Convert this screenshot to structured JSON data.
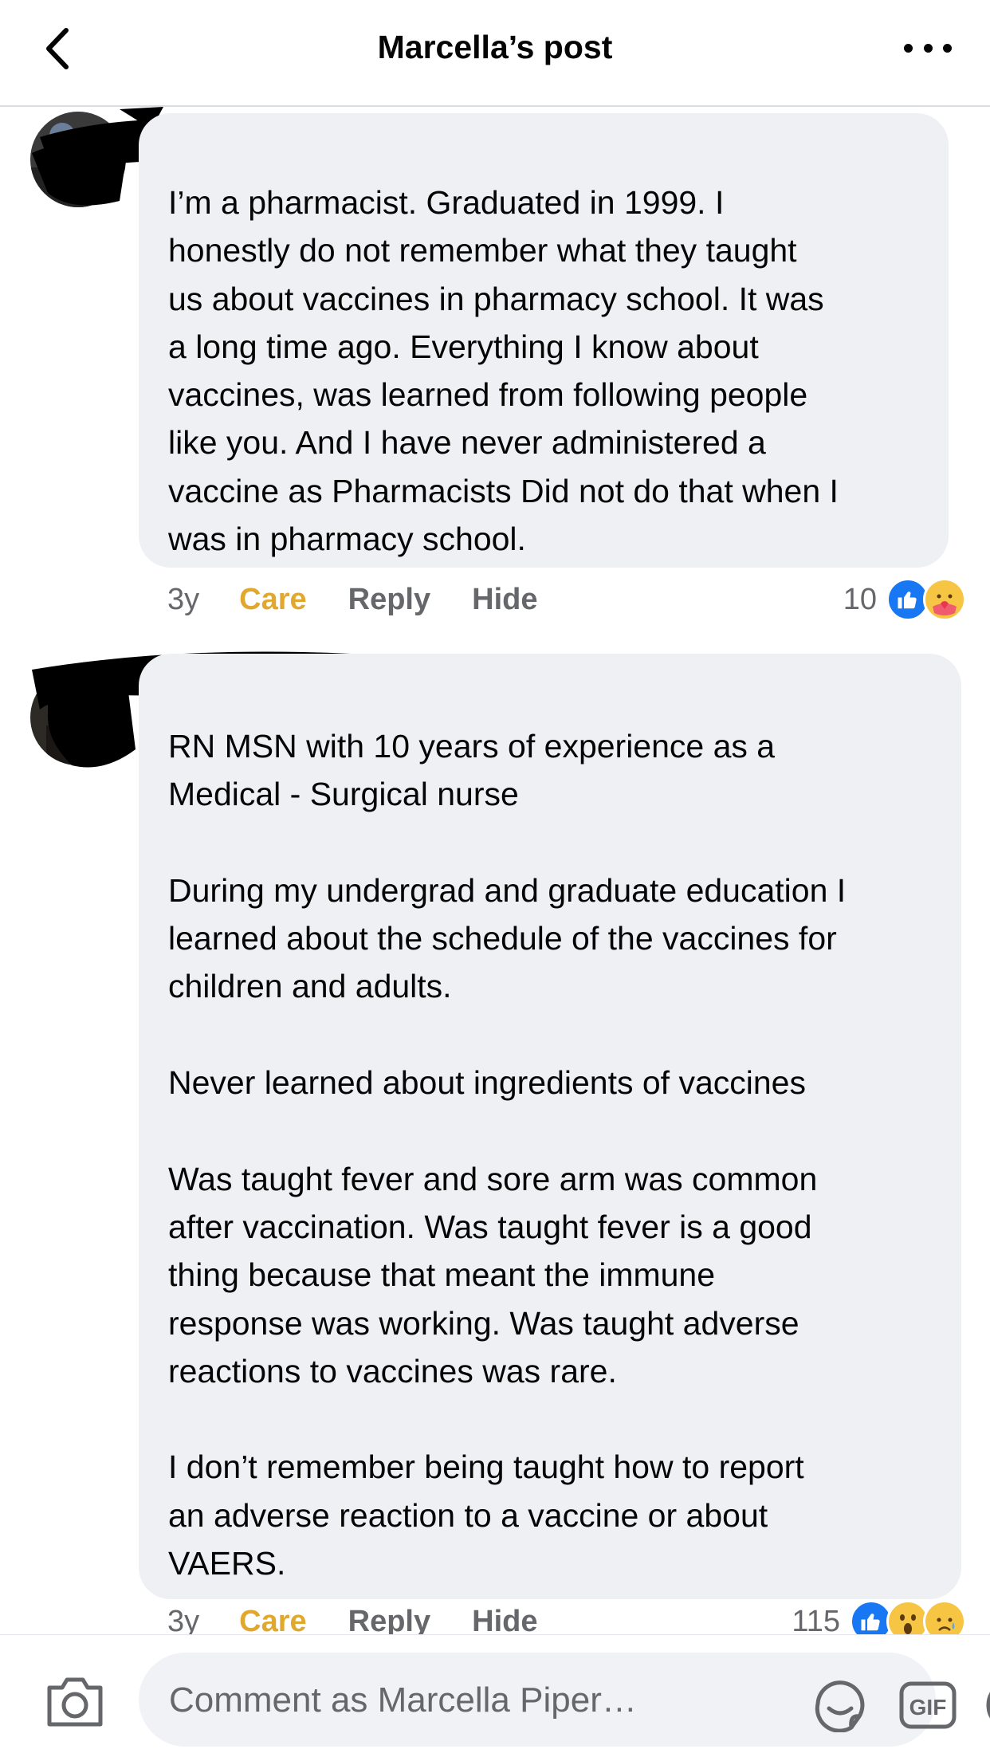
{
  "header": {
    "title": "Marcella’s post"
  },
  "comments": [
    {
      "author": "",
      "text": "I’m a pharmacist. Graduated in 1999. I\nhonestly do not remember what they taught\nus about vaccines in pharmacy school. It was\na long time ago. Everything I know about\nvaccines, was learned from following people\nlike you. And I have never administered a\nvaccine as Pharmacists Did not do that when I\nwas in pharmacy school.",
      "time": "3y",
      "care_label": "Care",
      "reply_label": "Reply",
      "hide_label": "Hide",
      "reaction_count": "10",
      "reactions": [
        "like-icon",
        "care-icon"
      ]
    },
    {
      "author": "",
      "text": "RN MSN with 10 years of experience as a\nMedical - Surgical nurse\n\nDuring my undergrad and graduate education I\nlearned about the schedule of the vaccines for\nchildren and adults.\n\nNever learned about ingredients of vaccines\n\nWas taught fever and sore arm was common\nafter vaccination. Was taught fever is a good\nthing because that meant the immune\nresponse was working. Was taught adverse\nreactions to vaccines was rare.\n\nI don’t remember being taught how to report\nan adverse reaction to a vaccine or about\nVAERS.",
      "time": "3y",
      "care_label": "Care",
      "reply_label": "Reply",
      "hide_label": "Hide",
      "reaction_count": "115",
      "reactions": [
        "like-icon",
        "wow-icon",
        "sad-icon"
      ]
    }
  ],
  "composer": {
    "placeholder": "Comment as Marcella Piper…"
  },
  "colors": {
    "bubble": "#eff0f4",
    "care": "#e0a82e",
    "like_blue": "#1877f2",
    "muted_text": "#65676b"
  }
}
